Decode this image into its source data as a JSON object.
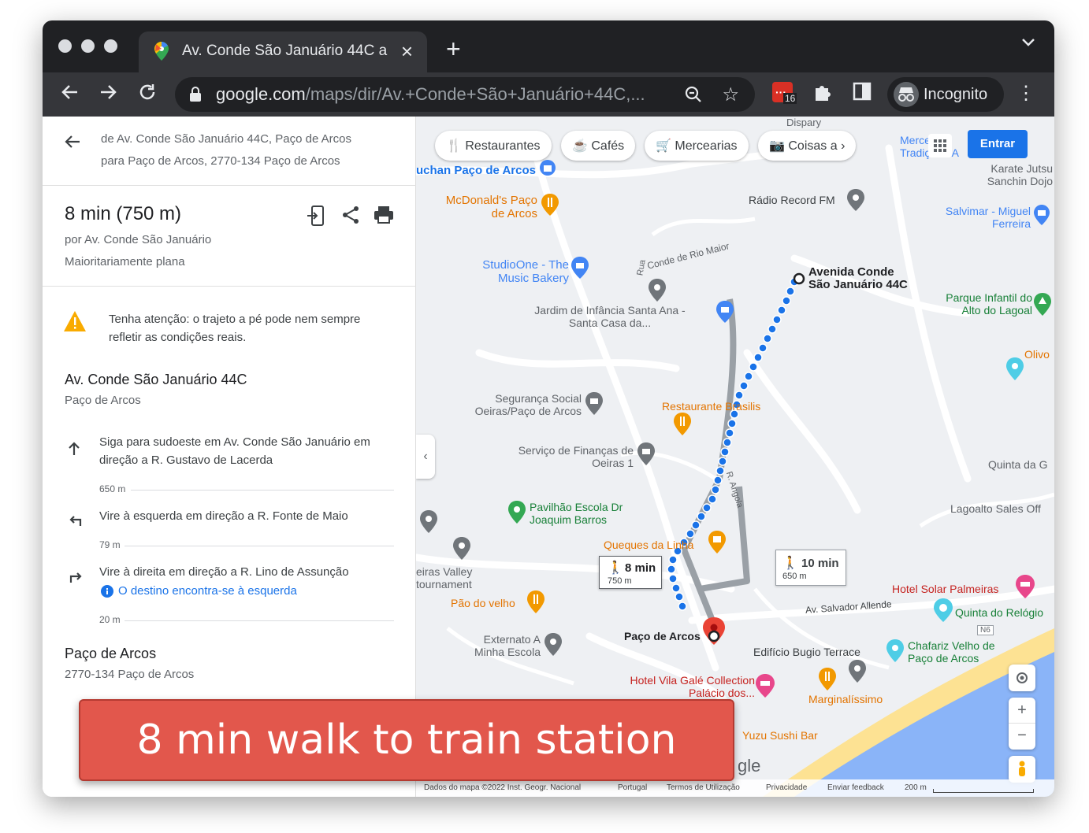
{
  "browser": {
    "tab_title": "Av. Conde São Januário 44C a",
    "tab_close": "×",
    "new_tab": "+",
    "url_host": "google.com",
    "url_path": "/maps/dir/Av.+Conde+São+Januário+44C,...",
    "extension_badge": "16",
    "profile_label": "Incognito"
  },
  "panel": {
    "from": "de Av. Conde São Januário 44C, Paço de Arcos",
    "to": "para Paço de Arcos, 2770-134 Paço de Arcos",
    "duration": "8 min (750 m)",
    "via": "por Av. Conde São Januário",
    "terrain": "Maioritariamente plana",
    "warning": "Tenha atenção: o trajeto a pé pode nem sempre refletir as condições reais.",
    "origin_name": "Av. Conde São Januário 44C",
    "origin_sub": "Paço de Arcos",
    "steps": [
      {
        "text": "Siga para sudoeste em Av. Conde São Januário em direção a R. Gustavo de Lacerda",
        "distance": "650 m",
        "icon": "arrow-up-icon"
      },
      {
        "text": "Vire à esquerda em direção a R. Fonte de Maio",
        "distance": "79 m",
        "icon": "turn-left-icon"
      },
      {
        "text": "Vire à direita em direção a R. Lino de Assunção",
        "note": "O destino encontra-se à esquerda",
        "distance": "20 m",
        "icon": "turn-right-icon"
      }
    ],
    "dest_name": "Paço de Arcos",
    "dest_sub": "2770-134 Paço de Arcos"
  },
  "map": {
    "chips": [
      "Restaurantes",
      "Cafés",
      "Mercearias",
      "Coisas a"
    ],
    "login": "Entrar",
    "labels": {
      "dispary": "Dispary",
      "mercearia": "Mercearia Tradição - A",
      "karate": "Karate Jutsu Sanchin Dojo",
      "uchan": "uchan Paço de Arcos",
      "mcdonald": "McDonald's Paço de Arcos",
      "radio": "Rádio Record FM",
      "salvimar": "Salvimar - Miguel Ferreira",
      "conde_rio": "Conde de Rio Maior",
      "rua": "Rua",
      "studioone": "StudioOne - The Music Bakery",
      "origin": "Avenida Conde São Januário 44C",
      "parque": "Parque Infantil do Alto do Lagoal",
      "jardim": "Jardim de Infância Santa Ana - Santa Casa da...",
      "olivo": "Olivo",
      "seguranca": "Segurança Social Oeiras/Paço de Arcos",
      "restaurante": "Restaurante Brasilis",
      "servico": "Serviço de Finanças de Oeiras 1",
      "quinta_g": "Quinta da G",
      "r_angola": "R. Angola",
      "lagoalto": "Lagoalto Sales Off",
      "pavilhao": "Pavilhão Escola Dr Joaquim Barros",
      "queques": "Queques da Linha",
      "valley": "eiras Valley tournament",
      "hotel_solar": "Hotel Solar Palmeiras",
      "salvador": "Av. Salvador Allende",
      "quinta_relogio": "Quinta do Relógio",
      "pao": "Pão do velho",
      "destination": "Paço de Arcos",
      "n6": "N6",
      "externato": "Externato A Minha Escola",
      "bugio": "Edifício Bugio Terrace",
      "chafariz": "Chafariz Velho de Paço de Arcos",
      "hotel_vila": "Hotel Vila Galé Collection Palácio dos...",
      "marginalissimo": "Marginalíssimo",
      "yuzu": "Yuzu Sushi Bar",
      "google": "gle"
    },
    "walk_callout": {
      "time": "8 min",
      "dist": "750 m"
    },
    "alt_callout": {
      "time": "10 min",
      "dist": "650 m"
    },
    "footer": {
      "data": "Dados do mapa ©2022 Inst. Geogr. Nacional",
      "country": "Portugal",
      "terms": "Termos de Utilização",
      "privacy": "Privacidade",
      "feedback": "Enviar feedback",
      "scale": "200 m"
    }
  },
  "banner": "8 min walk to train station",
  "colors": {
    "route": "#1a73e8",
    "accent": "#e2574c",
    "chrome_dark": "#202124"
  }
}
